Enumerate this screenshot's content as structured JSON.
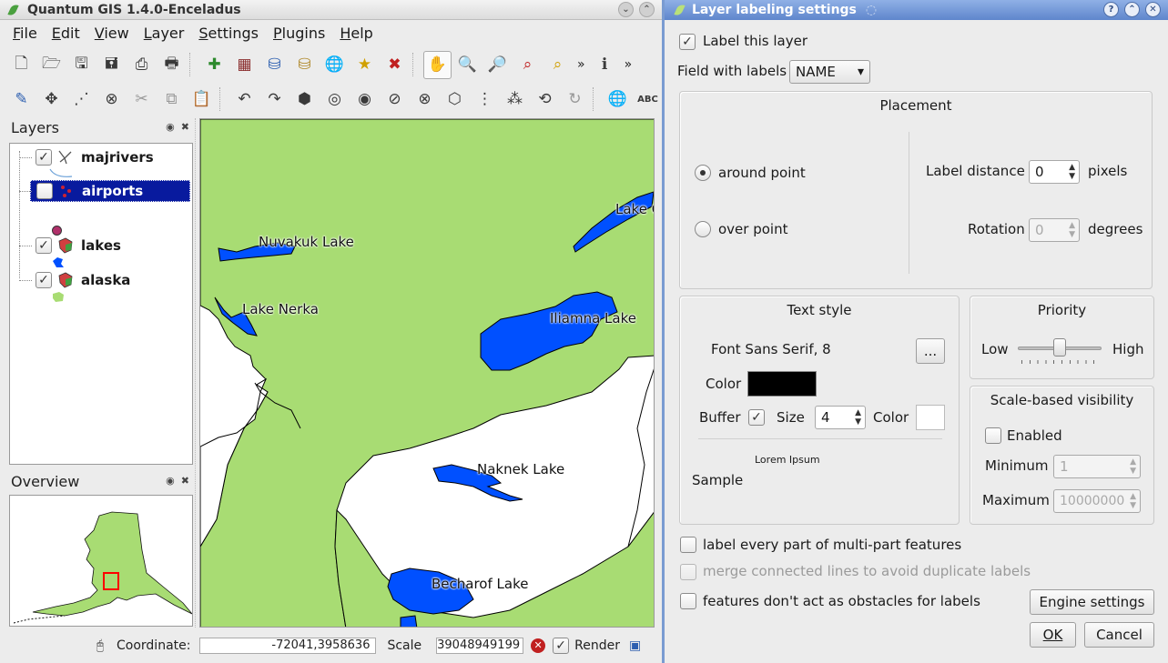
{
  "qgis": {
    "title": "Quantum GIS 1.4.0-Enceladus",
    "menus": [
      "File",
      "Edit",
      "View",
      "Layer",
      "Settings",
      "Plugins",
      "Help"
    ],
    "menu_mnemonics": [
      "F",
      "E",
      "V",
      "L",
      "S",
      "P",
      "H"
    ],
    "more_glyph": "»",
    "layers_panel": {
      "title": "Layers",
      "layers": [
        {
          "name": "majrivers",
          "checked": true,
          "selected": false
        },
        {
          "name": "airports",
          "checked": false,
          "selected": true
        },
        {
          "name": "lakes",
          "checked": true,
          "selected": false
        },
        {
          "name": "alaska",
          "checked": true,
          "selected": false
        }
      ]
    },
    "overview_panel": {
      "title": "Overview"
    },
    "map_labels": [
      "Nuvakuk Lake",
      "Lake Nerka",
      "Lake C",
      "Iliamna Lake",
      "Naknek Lake",
      "Becharof Lake"
    ],
    "colors": {
      "land": "#a8dc73",
      "water": "#0050ff",
      "selected_layer": "#081a9e",
      "overview_extent": "#ff0000"
    },
    "status": {
      "coordinate_label": "Coordinate:",
      "coordinate_value": "-72041,3958636",
      "scale_label": "Scale",
      "scale_value": "39048949199",
      "render_label": "Render",
      "render_checked": true
    }
  },
  "dialog": {
    "title": "Layer labeling settings",
    "label_this_layer": {
      "label": "Label this layer",
      "checked": true
    },
    "field_with_labels": {
      "label": "Field with labels",
      "value": "NAME"
    },
    "placement": {
      "title": "Placement",
      "around_point": {
        "label": "around point",
        "selected": true
      },
      "over_point": {
        "label": "over point",
        "selected": false
      },
      "label_distance": {
        "label": "Label distance",
        "value": "0",
        "unit": "pixels"
      },
      "rotation": {
        "label": "Rotation",
        "value": "0",
        "unit": "degrees"
      }
    },
    "text_style": {
      "title": "Text style",
      "font": "Font Sans Serif, 8",
      "font_button": "...",
      "color_label": "Color",
      "color_value": "#000000",
      "buffer_label": "Buffer",
      "buffer_checked": true,
      "size_label": "Size",
      "size_value": "4",
      "buffer_color_label": "Color",
      "buffer_color_value": "#ffffff",
      "sample_label": "Sample",
      "sample_text": "Lorem Ipsum"
    },
    "priority": {
      "title": "Priority",
      "low": "Low",
      "high": "High",
      "level_fraction": 0.5
    },
    "scale_visibility": {
      "title": "Scale-based visibility",
      "enabled_label": "Enabled",
      "enabled_checked": false,
      "minimum_label": "Minimum",
      "minimum_value": "1",
      "maximum_label": "Maximum",
      "maximum_value": "10000000"
    },
    "options": [
      {
        "label": "label every part of multi-part features",
        "checked": false,
        "disabled": false
      },
      {
        "label": "merge connected lines to avoid duplicate labels",
        "checked": false,
        "disabled": true
      },
      {
        "label": "features don't act as obstacles for labels",
        "checked": false,
        "disabled": false
      }
    ],
    "buttons": {
      "engine_settings": "Engine settings",
      "ok": "OK",
      "cancel": "Cancel"
    }
  }
}
